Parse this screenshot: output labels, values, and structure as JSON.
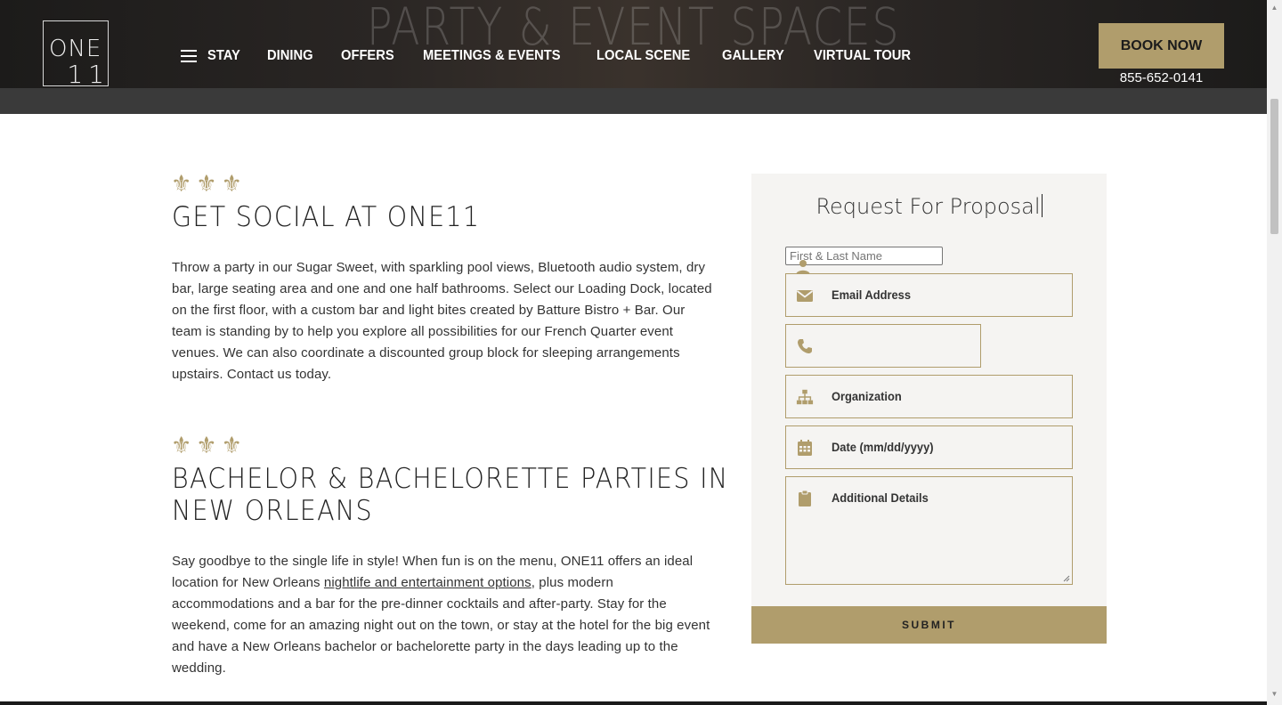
{
  "header": {
    "hero_title": "PARTY & EVENT SPACES",
    "logo": {
      "text_top": "ONE",
      "text_bottom": "11"
    },
    "nav": [
      "STAY",
      "DINING",
      "OFFERS",
      "MEETINGS & EVENTS",
      "LOCAL SCENE",
      "GALLERY",
      "VIRTUAL TOUR"
    ],
    "book_now": "BOOK NOW",
    "phone": "855-652-0141"
  },
  "sections": [
    {
      "fleurs": "⚜⚜⚜",
      "title": "GET SOCIAL AT ONE11",
      "body": "Throw a party in our Sugar Sweet, with sparkling pool views, Bluetooth audio system, dry bar, large seating area and one and one half bathrooms.  Select our Loading Dock, located on the first floor, with a custom bar and light bites created by Batture Bistro + Bar. Our team is standing by to help you explore all possibilities for our French Quarter event venues. We can also coordinate a discounted group block for sleeping arrangements upstairs. Contact us today."
    },
    {
      "fleurs": "⚜⚜⚜",
      "title_line1": "BACHELOR & BACHELORETTE PARTIES IN",
      "title_line2": "NEW ORLEANS",
      "body_before_link": "Say goodbye to the single life in style! When fun is on the menu, ONE11 offers an ideal location for New Orleans ",
      "link": "nightlife and entertainment options",
      "body_after_link": ", plus modern accommodations and a bar for the pre-dinner cocktails and after-party. Stay for the weekend, come for an amazing night out on the town, or stay at the hotel for the big event and have a New Orleans bachelor or bachelorette party in the days leading up to the wedding."
    }
  ],
  "form": {
    "title": "Request For Proposal",
    "name_placeholder": "First & Last Name",
    "email_label": "Email Address",
    "phone_label": "",
    "organization_label": "Organization",
    "date_label": "Date (mm/dd/yyyy)",
    "details_label": "Additional Details",
    "submit": "SUBMIT"
  },
  "colors": {
    "gold": "#b09d6c",
    "panel": "#f5f4f2",
    "dark_band": "#3a3a3a"
  },
  "icons": [
    "hamburger-icon",
    "user-icon",
    "envelope-icon",
    "phone-icon",
    "sitemap-icon",
    "calendar-icon",
    "clipboard-icon"
  ]
}
